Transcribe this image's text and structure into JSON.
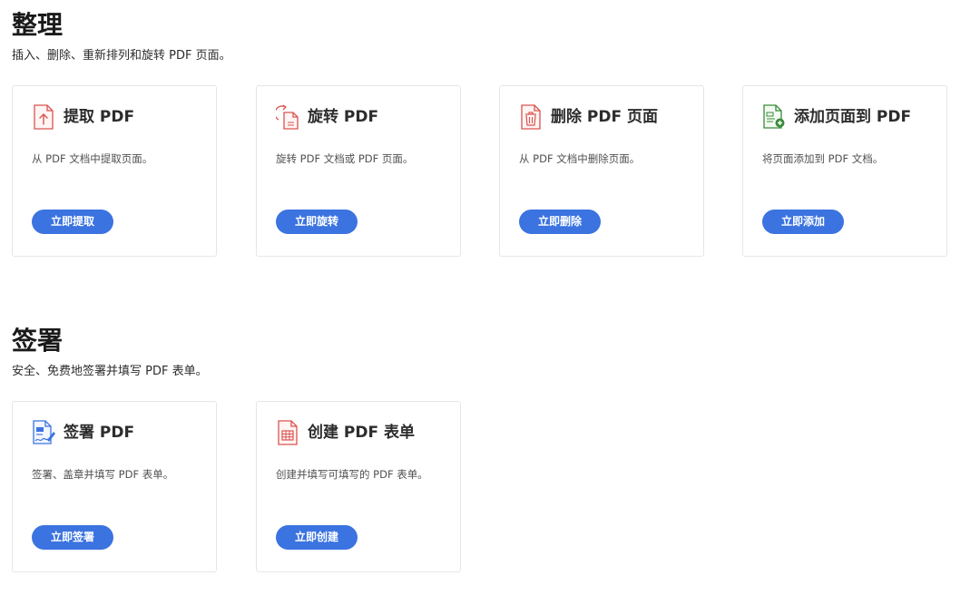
{
  "colors": {
    "accent_button": "#3b73e0",
    "icon_red": "#d9534f",
    "icon_green": "#3a8a3a",
    "icon_blue": "#3b73e0"
  },
  "organize": {
    "title": "整理",
    "description": "插入、删除、重新排列和旋转 PDF 页面。",
    "cards": [
      {
        "icon": "extract-pdf-icon",
        "title": "提取 PDF",
        "description": "从 PDF 文档中提取页面。",
        "button": "立即提取"
      },
      {
        "icon": "rotate-pdf-icon",
        "title": "旋转 PDF",
        "description": "旋转 PDF 文档或 PDF 页面。",
        "button": "立即旋转"
      },
      {
        "icon": "delete-pages-icon",
        "title": "删除 PDF 页面",
        "description": "从 PDF 文档中删除页面。",
        "button": "立即删除"
      },
      {
        "icon": "add-pages-icon",
        "title": "添加页面到 PDF",
        "description": "将页面添加到 PDF 文档。",
        "button": "立即添加"
      }
    ]
  },
  "sign": {
    "title": "签署",
    "description": "安全、免费地签署并填写 PDF 表单。",
    "cards": [
      {
        "icon": "sign-pdf-icon",
        "title": "签署 PDF",
        "description": "签署、盖章并填写 PDF 表单。",
        "button": "立即签署"
      },
      {
        "icon": "create-form-icon",
        "title": "创建 PDF 表单",
        "description": "创建并填写可填写的 PDF 表单。",
        "button": "立即创建"
      }
    ]
  }
}
